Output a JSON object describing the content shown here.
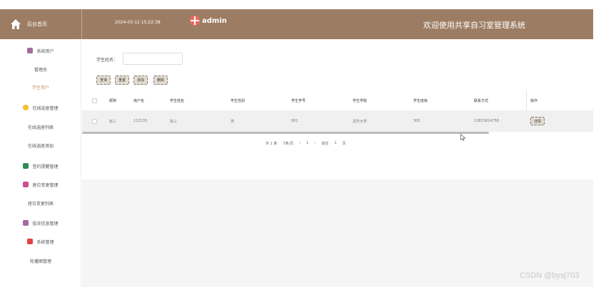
{
  "header": {
    "home_label": "后台首页",
    "datetime": "2024-03-12 15:22:38",
    "user": "admin",
    "title": "欢迎使用共享自习室管理系统",
    "bg_color": "#9c7d64"
  },
  "sidebar": {
    "items": [
      {
        "label": "系统用户",
        "icon": "user-group-icon",
        "color": "#a46ba0"
      },
      {
        "label": "管理员"
      },
      {
        "label": "学生用户",
        "active": true
      },
      {
        "label": "在线选座管理",
        "icon": "seat-icon",
        "color": "#f2c12e"
      },
      {
        "label": "在线选座列表"
      },
      {
        "label": "在线选座添加"
      },
      {
        "label": "签约提醒管理",
        "icon": "reminder-icon",
        "color": "#2e8b57"
      },
      {
        "label": "座位变更管理",
        "icon": "change-icon",
        "color": "#d04a8f"
      },
      {
        "label": "座位变更列表"
      },
      {
        "label": "投诉信息管理",
        "icon": "complaint-icon",
        "color": "#a46ba0"
      },
      {
        "label": "系统管理",
        "icon": "system-icon",
        "color": "#e0443e"
      },
      {
        "label": "轮播图管理"
      }
    ]
  },
  "search": {
    "label": "学生姓名：",
    "value": ""
  },
  "toolbar": {
    "query": "查询",
    "reset": "重置",
    "add": "添加",
    "delete": "删除"
  },
  "table": {
    "columns": [
      "昵称",
      "用户名",
      "学生姓名",
      "学生性别",
      "学生学号",
      "学生学院",
      "学生班级",
      "联系方式",
      "操作"
    ],
    "rows": [
      {
        "nickname": "张三",
        "username": "112233",
        "name": "张三",
        "gender": "男",
        "student_no": "001",
        "college": "清华大学",
        "class": "305",
        "phone": "13823814758",
        "action": "详情"
      }
    ]
  },
  "pagination": {
    "total": "共 1 条",
    "page_size": "7条/页",
    "prev": "‹",
    "current": "1",
    "next": "›",
    "goto_label": "前往",
    "goto_value": "1",
    "page_suffix": "页"
  },
  "watermark": "CSDN @bysj703"
}
